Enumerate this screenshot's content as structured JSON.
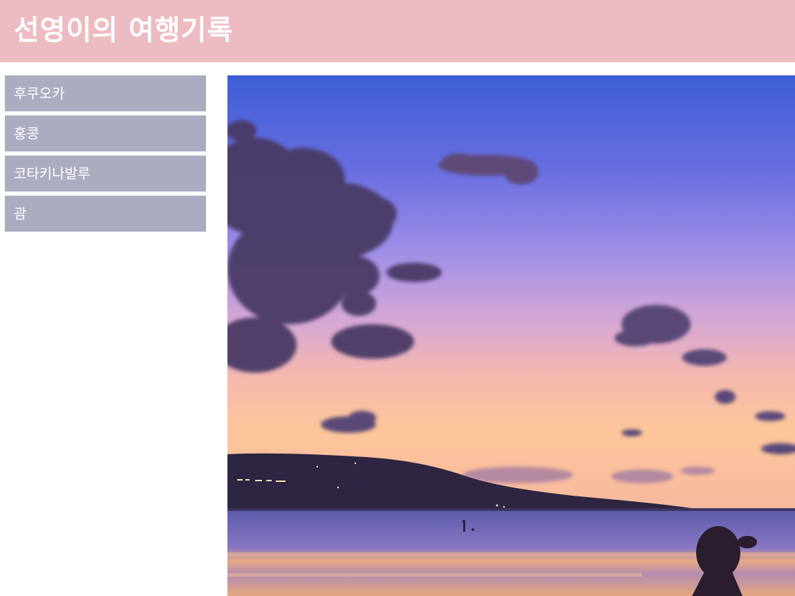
{
  "header": {
    "title": "선영이의 여행기록"
  },
  "nav": {
    "items": [
      {
        "label": "후쿠오카"
      },
      {
        "label": "홍콩"
      },
      {
        "label": "코타키나발루"
      },
      {
        "label": "괌"
      }
    ]
  },
  "colors": {
    "header_bg": "#edbcc2",
    "nav_bg": "#aaacc0",
    "text": "#ffffff"
  }
}
